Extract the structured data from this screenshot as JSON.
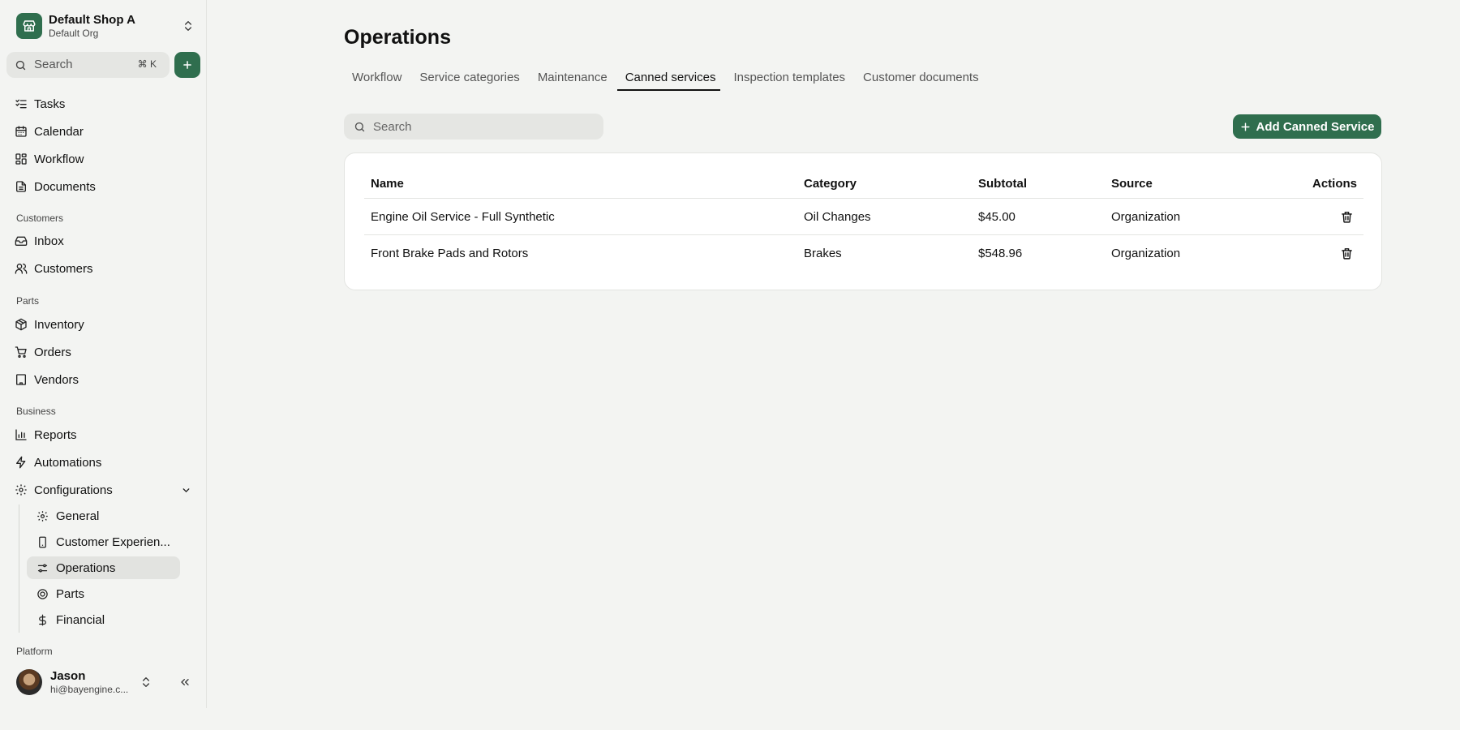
{
  "shop": {
    "name": "Default Shop A",
    "org": "Default Org"
  },
  "sidebar": {
    "search_label": "Search",
    "search_shortcut": "⌘ K",
    "top_items": [
      {
        "label": "Tasks",
        "icon": "list-check-icon"
      },
      {
        "label": "Calendar",
        "icon": "calendar-icon"
      },
      {
        "label": "Workflow",
        "icon": "kanban-icon"
      },
      {
        "label": "Documents",
        "icon": "file-icon"
      }
    ],
    "sections": {
      "customers": "Customers",
      "parts": "Parts",
      "business": "Business",
      "platform": "Platform"
    },
    "customer_items": [
      {
        "label": "Inbox",
        "icon": "inbox-icon"
      },
      {
        "label": "Customers",
        "icon": "users-icon"
      }
    ],
    "parts_items": [
      {
        "label": "Inventory",
        "icon": "package-icon"
      },
      {
        "label": "Orders",
        "icon": "cart-icon"
      },
      {
        "label": "Vendors",
        "icon": "building-icon"
      }
    ],
    "business_items": [
      {
        "label": "Reports",
        "icon": "bar-chart-icon"
      },
      {
        "label": "Automations",
        "icon": "bolt-icon"
      },
      {
        "label": "Configurations",
        "icon": "gear-icon"
      }
    ],
    "config_subitems": [
      {
        "label": "General",
        "icon": "gear-icon"
      },
      {
        "label": "Customer Experien...",
        "icon": "phone-icon"
      },
      {
        "label": "Operations",
        "icon": "sliders-icon"
      },
      {
        "label": "Parts",
        "icon": "tire-icon"
      },
      {
        "label": "Financial",
        "icon": "dollar-icon"
      }
    ]
  },
  "user": {
    "name": "Jason",
    "email": "hi@bayengine.c..."
  },
  "main": {
    "title": "Operations",
    "tabs": [
      {
        "label": "Workflow",
        "active": false
      },
      {
        "label": "Service categories",
        "active": false
      },
      {
        "label": "Maintenance",
        "active": false
      },
      {
        "label": "Canned services",
        "active": true
      },
      {
        "label": "Inspection templates",
        "active": false
      },
      {
        "label": "Customer documents",
        "active": false
      }
    ],
    "search_placeholder": "Search",
    "add_button": "Add Canned Service",
    "table": {
      "headers": {
        "name": "Name",
        "category": "Category",
        "subtotal": "Subtotal",
        "source": "Source",
        "actions": "Actions"
      },
      "rows": [
        {
          "name": "Engine Oil Service - Full Synthetic",
          "category": "Oil Changes",
          "subtotal": "$45.00",
          "source": "Organization"
        },
        {
          "name": "Front Brake Pads and Rotors",
          "category": "Brakes",
          "subtotal": "$548.96",
          "source": "Organization"
        }
      ]
    }
  },
  "colors": {
    "accent": "#2f6e4e",
    "background": "#f3f4f2",
    "card": "#ffffff"
  }
}
